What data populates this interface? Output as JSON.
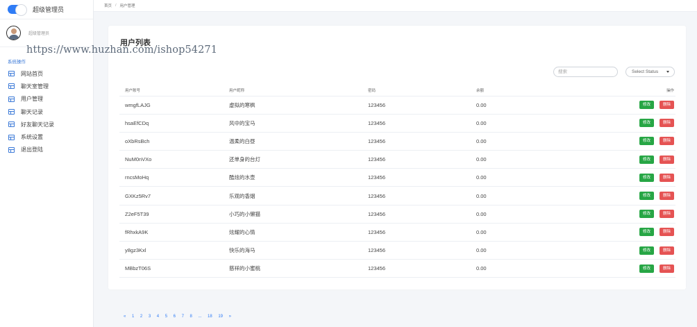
{
  "app": {
    "title": "超级管理员"
  },
  "user": {
    "role": "超级管理员"
  },
  "watermark": "https://www.huzhan.com/ishop54271",
  "breadcrumb": [
    "首页",
    "用户管理"
  ],
  "breadcrumb_separator": "/",
  "sidebar": {
    "section_header": "系统操作",
    "items": [
      {
        "label": "网站首页",
        "icon": "window-icon"
      },
      {
        "label": "聊天室管理",
        "icon": "window-icon"
      },
      {
        "label": "用户管理",
        "icon": "window-icon"
      },
      {
        "label": "聊天记录",
        "icon": "window-icon"
      },
      {
        "label": "好友聊天记录",
        "icon": "window-icon"
      },
      {
        "label": "系统设置",
        "icon": "window-icon"
      },
      {
        "label": "退出登陆",
        "icon": "window-icon"
      }
    ]
  },
  "main": {
    "title": "用户列表",
    "search_placeholder": "搜索",
    "status_select": "Select Status",
    "columns": [
      "用户账号",
      "用户昵称",
      "密码",
      "余额",
      "操作"
    ],
    "edit_label": "修改",
    "delete_label": "删除",
    "rows": [
      {
        "account": "wmgfLAJG",
        "nickname": "虚拟的寒枫",
        "password": "123456",
        "balance": "0.00"
      },
      {
        "account": "hsaEfCDq",
        "nickname": "风中的宝马",
        "password": "123456",
        "balance": "0.00"
      },
      {
        "account": "oXbRsBch",
        "nickname": "温柔的白昼",
        "password": "123456",
        "balance": "0.00"
      },
      {
        "account": "NuM0nVXo",
        "nickname": "还单身的台灯",
        "password": "123456",
        "balance": "0.00"
      },
      {
        "account": "rncsMoHq",
        "nickname": "酷炫的水壶",
        "password": "123456",
        "balance": "0.00"
      },
      {
        "account": "GXKz5Rv7",
        "nickname": "乐观的香烟",
        "password": "123456",
        "balance": "0.00"
      },
      {
        "account": "Z2eF5T39",
        "nickname": "小巧的小懒猫",
        "password": "123456",
        "balance": "0.00"
      },
      {
        "account": "fRhxkA9K",
        "nickname": "炫耀的心情",
        "password": "123456",
        "balance": "0.00"
      },
      {
        "account": "y8gz3Kxl",
        "nickname": "快乐的海马",
        "password": "123456",
        "balance": "0.00"
      },
      {
        "account": "MBbzT06S",
        "nickname": "慈祥的小蜜桃",
        "password": "123456",
        "balance": "0.00"
      }
    ]
  },
  "pagination": [
    "«",
    "1",
    "2",
    "3",
    "4",
    "5",
    "6",
    "7",
    "8",
    "...",
    "18",
    "19",
    "»"
  ],
  "colors": {
    "accent": "#2f7cf6",
    "edit": "#27a645",
    "delete": "#e55353",
    "nav_icon": "#3c7ad8"
  }
}
